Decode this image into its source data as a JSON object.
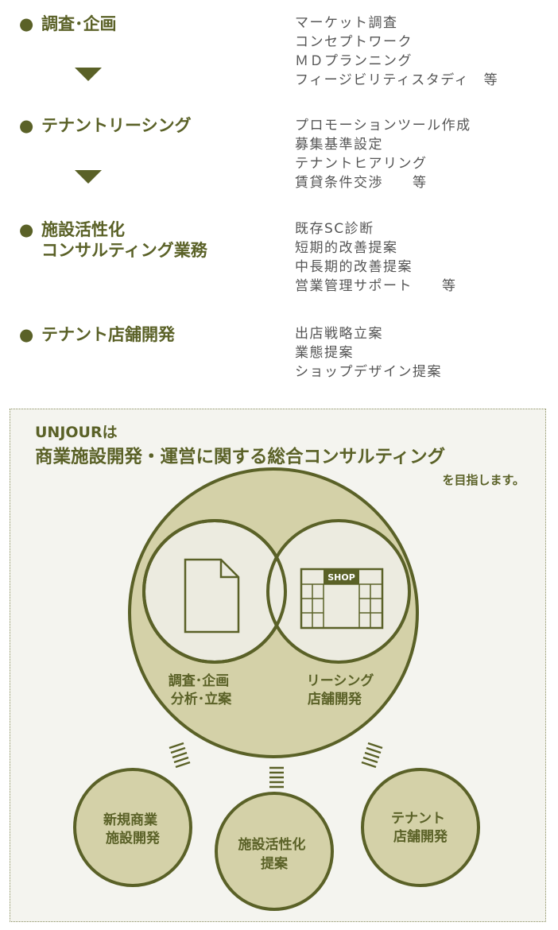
{
  "services": [
    {
      "title_lines": [
        "調査･企画"
      ],
      "items": [
        "マーケット調査",
        "コンセプトワーク",
        "ＭＤプランニング",
        "フィージビリティスタディ　等"
      ]
    },
    {
      "title_lines": [
        "テナントリーシング"
      ],
      "items": [
        "プロモーションツール作成",
        "募集基準設定",
        "テナントヒアリング",
        "賃貸条件交渉　　等"
      ]
    },
    {
      "title_lines": [
        "施設活性化",
        "コンサルティング業務"
      ],
      "items": [
        "既存SC診断",
        "短期的改善提案",
        "中長期的改善提案",
        "営業管理サポート　　等"
      ]
    },
    {
      "title_lines": [
        "テナント店舗開発"
      ],
      "items": [
        "出店戦略立案",
        "業態提案",
        "ショップデザイン提案"
      ]
    }
  ],
  "diagram": {
    "heading_line1": "UNJOURは",
    "heading_line2": "商業施設開発・運営に関する総合コンサルティング",
    "heading_line3": "を目指します。",
    "left_circle_lines": [
      "調査･企画",
      "分析･立案"
    ],
    "right_circle_lines": [
      "リーシング",
      "店舗開発"
    ],
    "shop_label": "SHOP",
    "bottom_circles": [
      {
        "lines": [
          "新規商業",
          "施設開発"
        ]
      },
      {
        "lines": [
          "施設活性化",
          "提案"
        ]
      },
      {
        "lines": [
          "テナント",
          "店舗開発"
        ]
      }
    ]
  },
  "colors": {
    "olive_dark": "#5a6127",
    "circle_fill": "#d4d1a8",
    "inner_fill": "#ecebe0",
    "box_bg": "#f4f4ef",
    "text_gray": "#555555"
  }
}
